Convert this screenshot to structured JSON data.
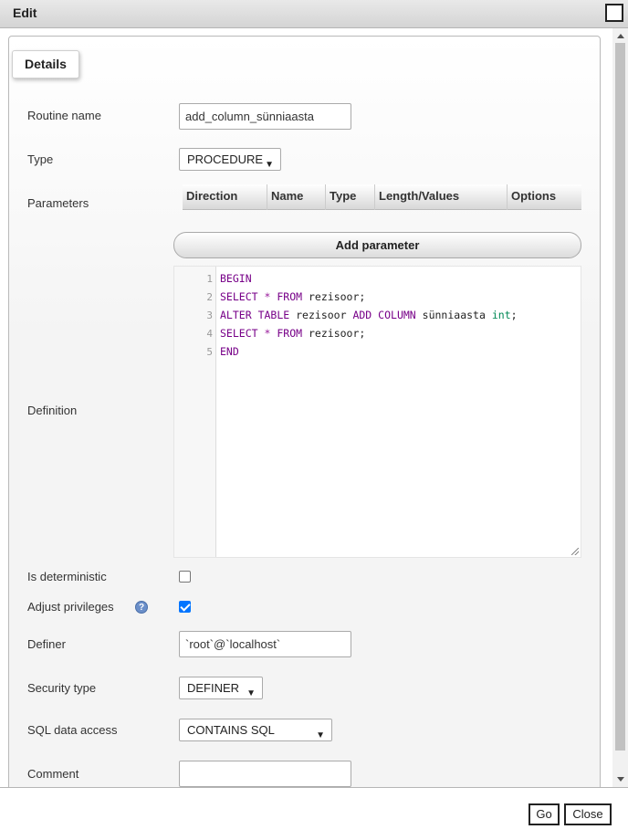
{
  "window": {
    "title": "Edit"
  },
  "tab": {
    "label": "Details"
  },
  "form": {
    "routine_name": {
      "label": "Routine name",
      "value": "add_column_sünniaasta"
    },
    "type": {
      "label": "Type",
      "value": "PROCEDURE"
    },
    "parameters": {
      "label": "Parameters",
      "columns": [
        "Direction",
        "Name",
        "Type",
        "Length/Values",
        "Options"
      ],
      "add_button": "Add parameter"
    },
    "definition": {
      "label": "Definition",
      "line_numbers": [
        "1",
        "2",
        "3",
        "4",
        "5"
      ],
      "lines": [
        "BEGIN",
        "SELECT * FROM rezisoor;",
        "ALTER TABLE rezisoor ADD COLUMN sünniaasta int;",
        "SELECT * FROM rezisoor;",
        "END"
      ]
    },
    "is_deterministic": {
      "label": "Is deterministic",
      "checked": false
    },
    "adjust_privileges": {
      "label": "Adjust privileges",
      "checked": true,
      "help_icon": "question-circle-icon"
    },
    "definer": {
      "label": "Definer",
      "value": "`root`@`localhost`"
    },
    "security_type": {
      "label": "Security type",
      "value": "DEFINER"
    },
    "sql_data_access": {
      "label": "SQL data access",
      "value": "CONTAINS SQL"
    },
    "comment": {
      "label": "Comment",
      "value": ""
    }
  },
  "footer": {
    "go_label": "Go",
    "close_label": "Close"
  },
  "colors": {
    "checkbox_checked": "#0075ff",
    "keyword": "#770088",
    "type": "#008855"
  }
}
